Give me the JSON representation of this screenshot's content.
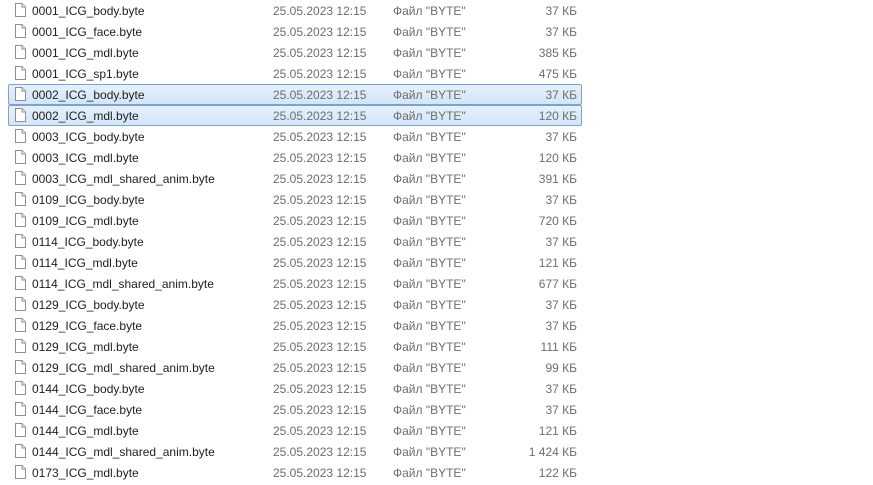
{
  "files": [
    {
      "name": "0001_ICG_body.byte",
      "date": "25.05.2023 12:15",
      "type": "Файл \"BYTE\"",
      "size": "37 КБ",
      "selected": false,
      "icon": "file-icon"
    },
    {
      "name": "0001_ICG_face.byte",
      "date": "25.05.2023 12:15",
      "type": "Файл \"BYTE\"",
      "size": "37 КБ",
      "selected": false,
      "icon": "file-icon"
    },
    {
      "name": "0001_ICG_mdl.byte",
      "date": "25.05.2023 12:15",
      "type": "Файл \"BYTE\"",
      "size": "385 КБ",
      "selected": false,
      "icon": "file-icon"
    },
    {
      "name": "0001_ICG_sp1.byte",
      "date": "25.05.2023 12:15",
      "type": "Файл \"BYTE\"",
      "size": "475 КБ",
      "selected": false,
      "icon": "file-icon"
    },
    {
      "name": "0002_ICG_body.byte",
      "date": "25.05.2023 12:15",
      "type": "Файл \"BYTE\"",
      "size": "37 КБ",
      "selected": true,
      "icon": "file-icon"
    },
    {
      "name": "0002_ICG_mdl.byte",
      "date": "25.05.2023 12:15",
      "type": "Файл \"BYTE\"",
      "size": "120 КБ",
      "selected": true,
      "icon": "file-icon"
    },
    {
      "name": "0003_ICG_body.byte",
      "date": "25.05.2023 12:15",
      "type": "Файл \"BYTE\"",
      "size": "37 КБ",
      "selected": false,
      "icon": "file-icon"
    },
    {
      "name": "0003_ICG_mdl.byte",
      "date": "25.05.2023 12:15",
      "type": "Файл \"BYTE\"",
      "size": "120 КБ",
      "selected": false,
      "icon": "file-icon"
    },
    {
      "name": "0003_ICG_mdl_shared_anim.byte",
      "date": "25.05.2023 12:15",
      "type": "Файл \"BYTE\"",
      "size": "391 КБ",
      "selected": false,
      "icon": "file-icon"
    },
    {
      "name": "0109_ICG_body.byte",
      "date": "25.05.2023 12:15",
      "type": "Файл \"BYTE\"",
      "size": "37 КБ",
      "selected": false,
      "icon": "file-icon"
    },
    {
      "name": "0109_ICG_mdl.byte",
      "date": "25.05.2023 12:15",
      "type": "Файл \"BYTE\"",
      "size": "720 КБ",
      "selected": false,
      "icon": "file-icon"
    },
    {
      "name": "0114_ICG_body.byte",
      "date": "25.05.2023 12:15",
      "type": "Файл \"BYTE\"",
      "size": "37 КБ",
      "selected": false,
      "icon": "file-icon"
    },
    {
      "name": "0114_ICG_mdl.byte",
      "date": "25.05.2023 12:15",
      "type": "Файл \"BYTE\"",
      "size": "121 КБ",
      "selected": false,
      "icon": "file-icon"
    },
    {
      "name": "0114_ICG_mdl_shared_anim.byte",
      "date": "25.05.2023 12:15",
      "type": "Файл \"BYTE\"",
      "size": "677 КБ",
      "selected": false,
      "icon": "file-icon"
    },
    {
      "name": "0129_ICG_body.byte",
      "date": "25.05.2023 12:15",
      "type": "Файл \"BYTE\"",
      "size": "37 КБ",
      "selected": false,
      "icon": "file-icon"
    },
    {
      "name": "0129_ICG_face.byte",
      "date": "25.05.2023 12:15",
      "type": "Файл \"BYTE\"",
      "size": "37 КБ",
      "selected": false,
      "icon": "file-icon"
    },
    {
      "name": "0129_ICG_mdl.byte",
      "date": "25.05.2023 12:15",
      "type": "Файл \"BYTE\"",
      "size": "111 КБ",
      "selected": false,
      "icon": "file-icon"
    },
    {
      "name": "0129_ICG_mdl_shared_anim.byte",
      "date": "25.05.2023 12:15",
      "type": "Файл \"BYTE\"",
      "size": "99 КБ",
      "selected": false,
      "icon": "file-icon"
    },
    {
      "name": "0144_ICG_body.byte",
      "date": "25.05.2023 12:15",
      "type": "Файл \"BYTE\"",
      "size": "37 КБ",
      "selected": false,
      "icon": "file-icon"
    },
    {
      "name": "0144_ICG_face.byte",
      "date": "25.05.2023 12:15",
      "type": "Файл \"BYTE\"",
      "size": "37 КБ",
      "selected": false,
      "icon": "file-icon"
    },
    {
      "name": "0144_ICG_mdl.byte",
      "date": "25.05.2023 12:15",
      "type": "Файл \"BYTE\"",
      "size": "121 КБ",
      "selected": false,
      "icon": "file-icon"
    },
    {
      "name": "0144_ICG_mdl_shared_anim.byte",
      "date": "25.05.2023 12:15",
      "type": "Файл \"BYTE\"",
      "size": "1 424 КБ",
      "selected": false,
      "icon": "file-icon"
    },
    {
      "name": "0173_ICG_mdl.byte",
      "date": "25.05.2023 12:15",
      "type": "Файл \"BYTE\"",
      "size": "122 КБ",
      "selected": false,
      "icon": "file-icon"
    }
  ]
}
